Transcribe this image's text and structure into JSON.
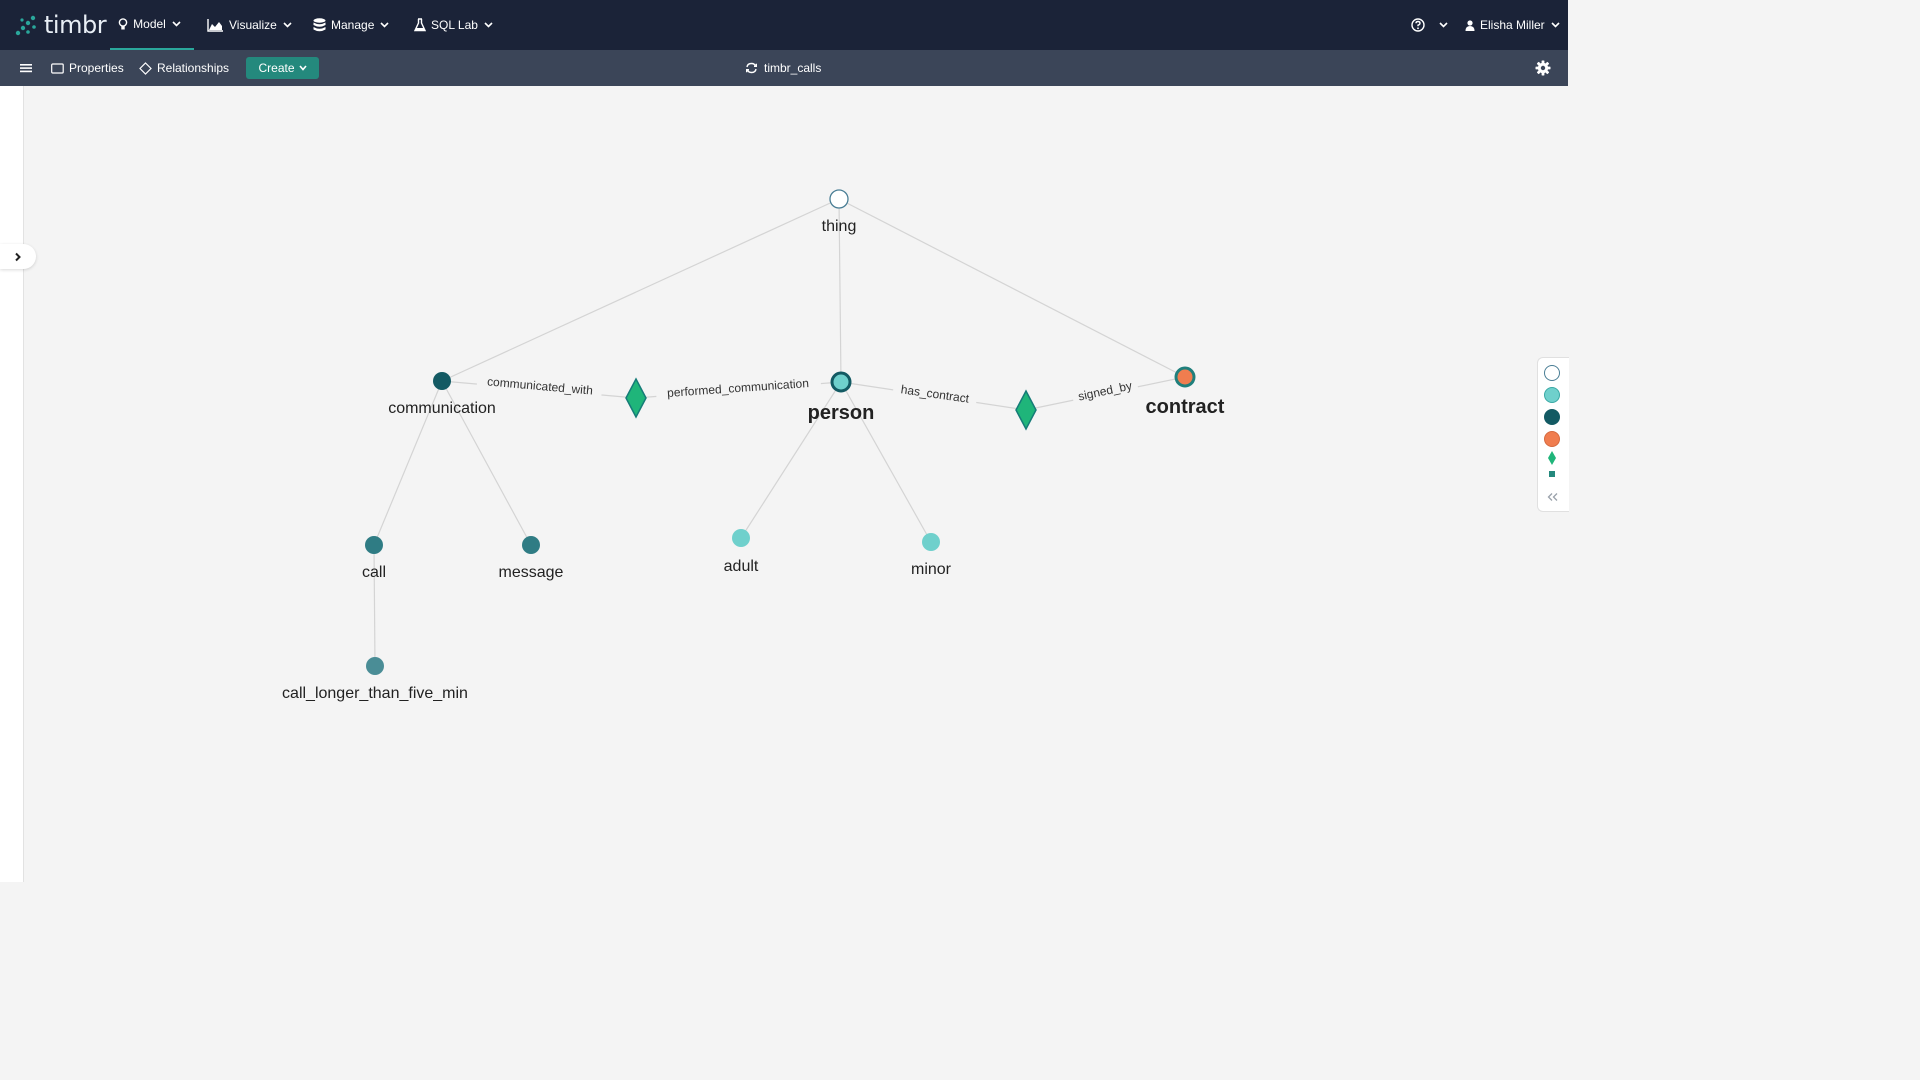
{
  "app": {
    "logo_text": "timbr"
  },
  "nav": {
    "items": [
      {
        "label": "Model",
        "icon": "lightbulb-icon"
      },
      {
        "label": "Visualize",
        "icon": "area-chart-icon"
      },
      {
        "label": "Manage",
        "icon": "database-icon"
      },
      {
        "label": "SQL Lab",
        "icon": "flask-icon"
      }
    ],
    "user": "Elisha Miller"
  },
  "toolbar": {
    "properties": "Properties",
    "relationships": "Relationships",
    "create": "Create",
    "ontology": "timbr_calls"
  },
  "graph": {
    "nodes": {
      "thing": "thing",
      "communication": "communication",
      "person": "person",
      "contract": "contract",
      "call": "call",
      "message": "message",
      "adult": "adult",
      "minor": "minor",
      "call_long": "call_longer_than_five_min"
    },
    "edges": {
      "communicated_with": "communicated_with",
      "performed_communication": "performed_communication",
      "has_contract": "has_contract",
      "signed_by": "signed_by"
    }
  },
  "colors": {
    "topbar": "#1b2338",
    "subbar": "#3b4558",
    "accent": "#24897d",
    "node_dark": "#135a63",
    "node_mid": "#3e8a92",
    "node_light": "#6fd0cc",
    "node_orange": "#f07d4f",
    "relation": "#1fb57a"
  }
}
